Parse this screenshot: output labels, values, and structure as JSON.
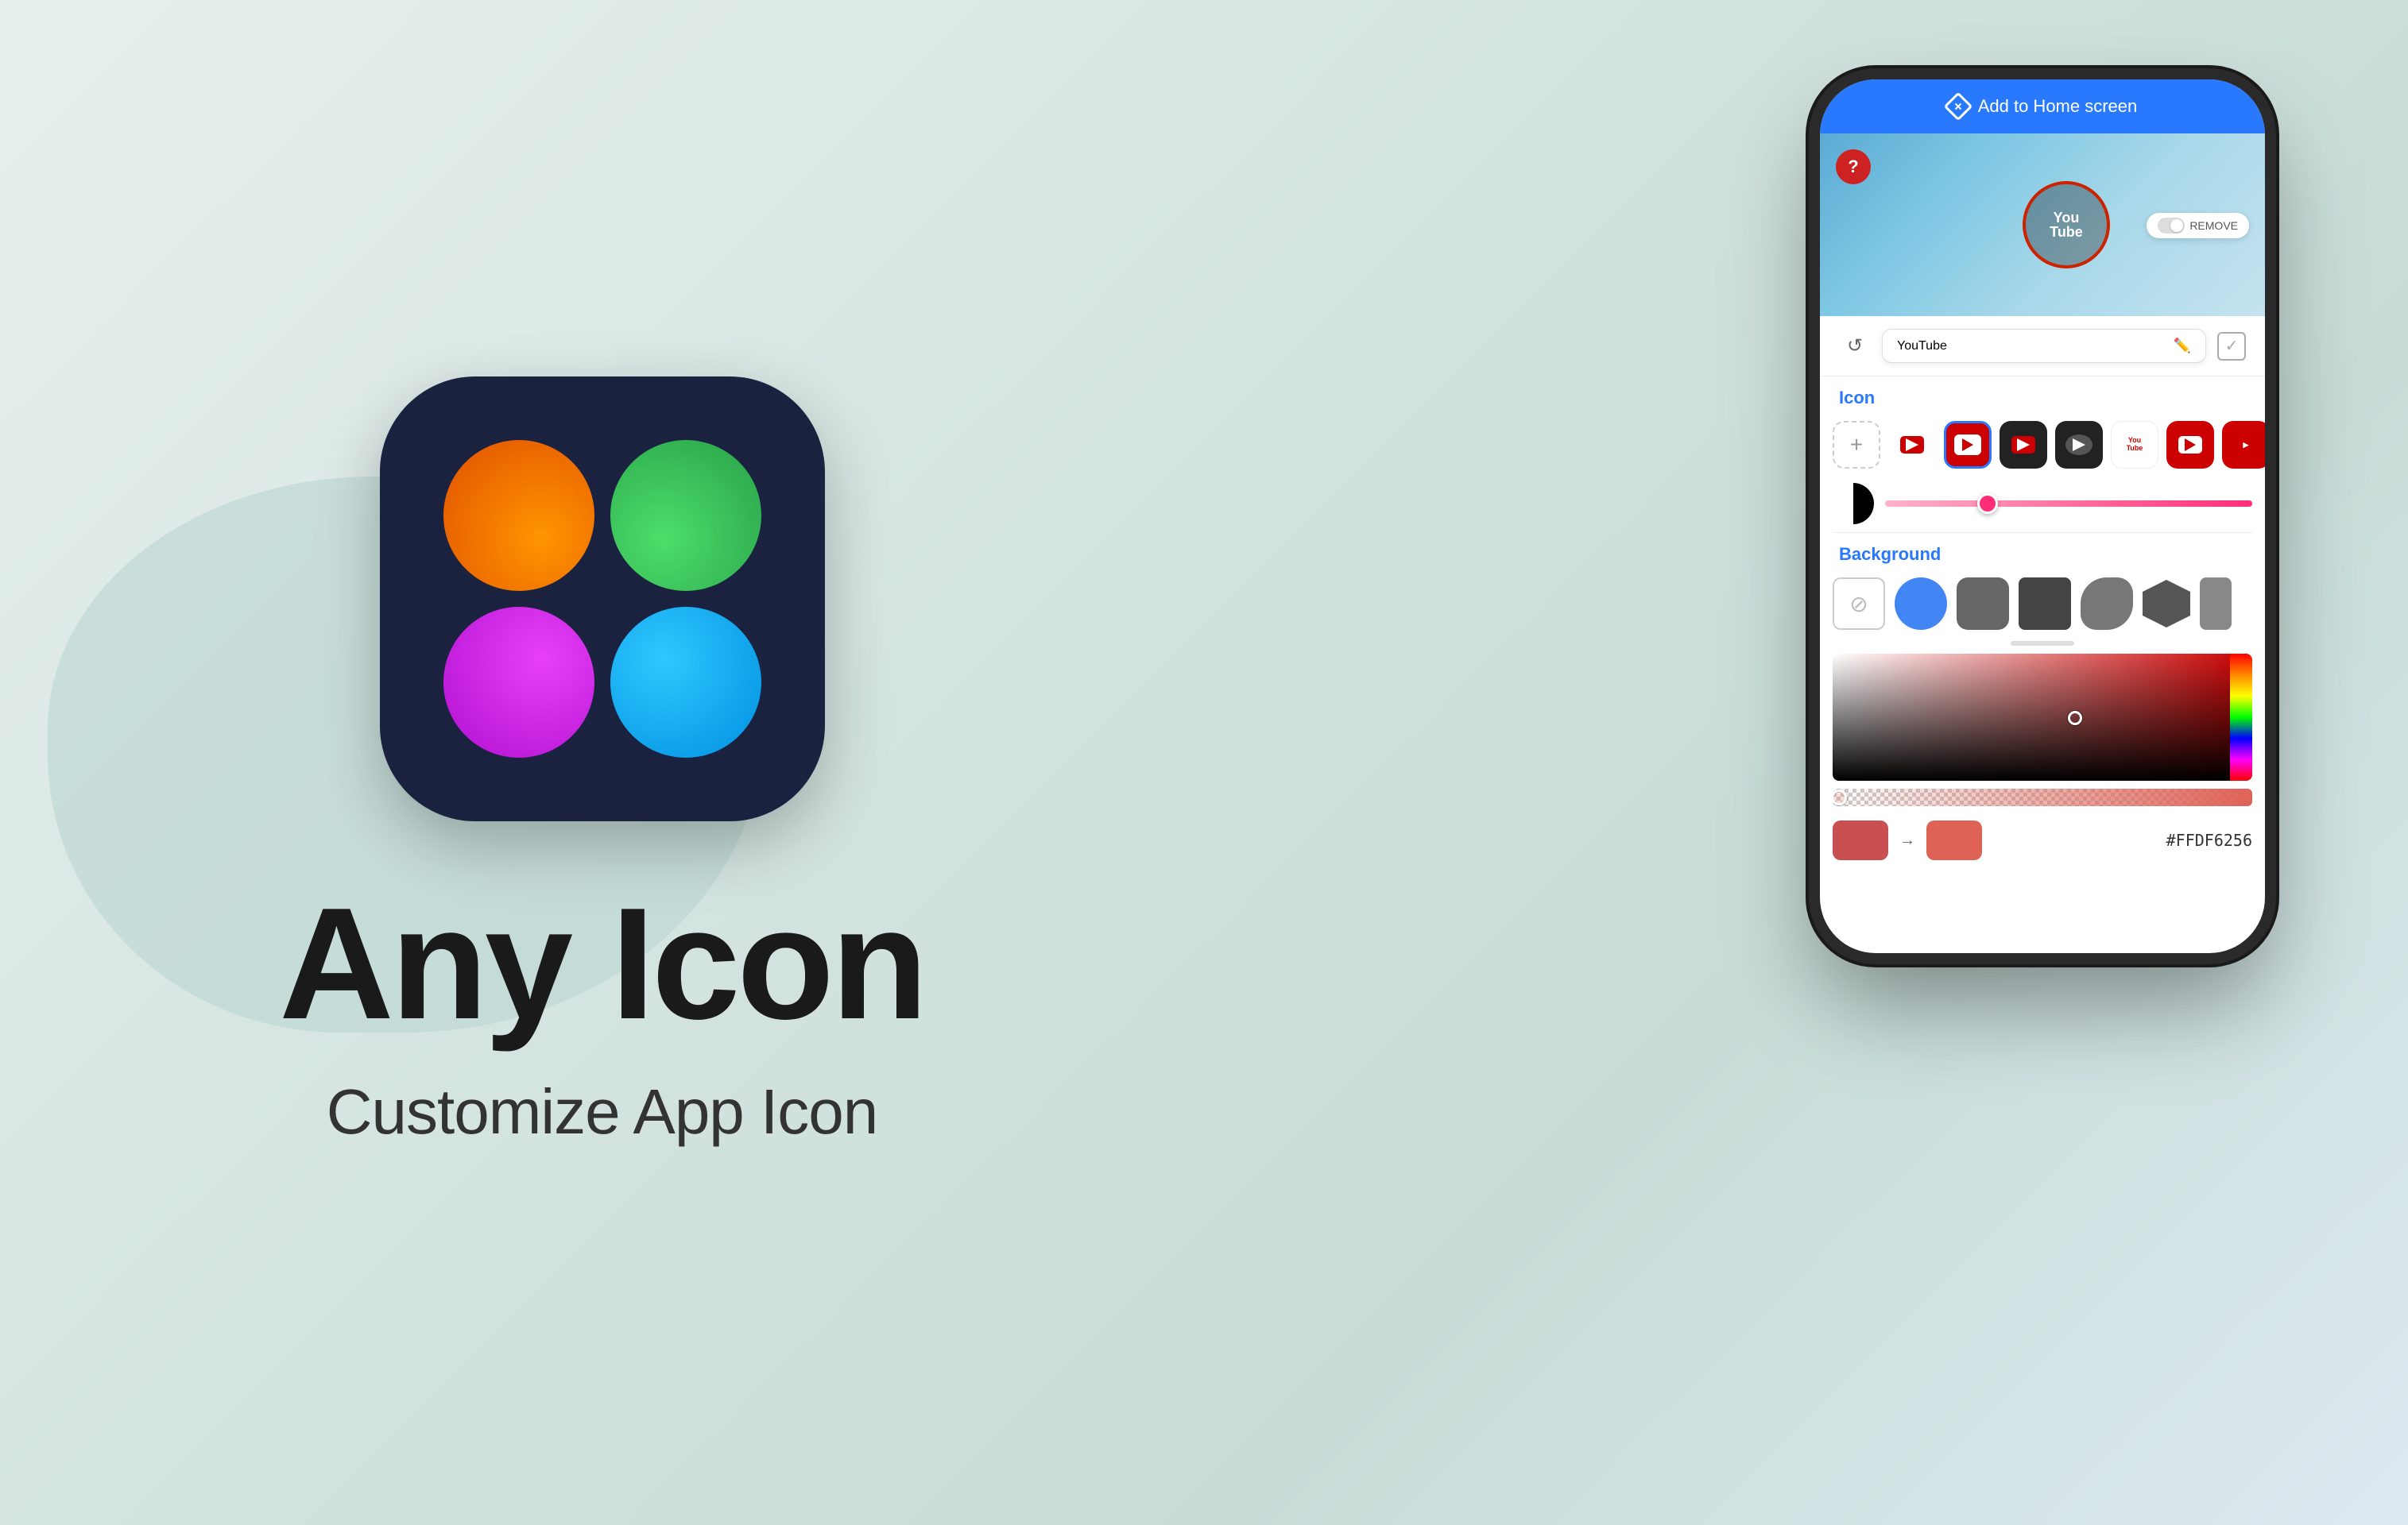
{
  "app": {
    "title": "Any Icon",
    "subtitle": "Customize App Icon"
  },
  "phone": {
    "header": {
      "add_to_home": "Add to Home screen"
    },
    "preview": {
      "app_name": "YouTube",
      "remove_label": "REMOVE",
      "question_mark": "?"
    },
    "name_row": {
      "app_name_value": "YouTube",
      "edit_icon": "✏️",
      "check": "✓"
    },
    "icon_section": {
      "label": "Icon",
      "add_label": "+",
      "icons": [
        "yt1",
        "yt2",
        "yt3",
        "yt4",
        "yt5",
        "yt6",
        "yt7"
      ]
    },
    "background_section": {
      "label": "Background",
      "shapes": [
        "none",
        "circle",
        "square-rounded",
        "square-dark",
        "squircle",
        "hexagon",
        "partial"
      ]
    },
    "color_hex": "#FFDF6256",
    "color_display": "# FFDF6256"
  }
}
